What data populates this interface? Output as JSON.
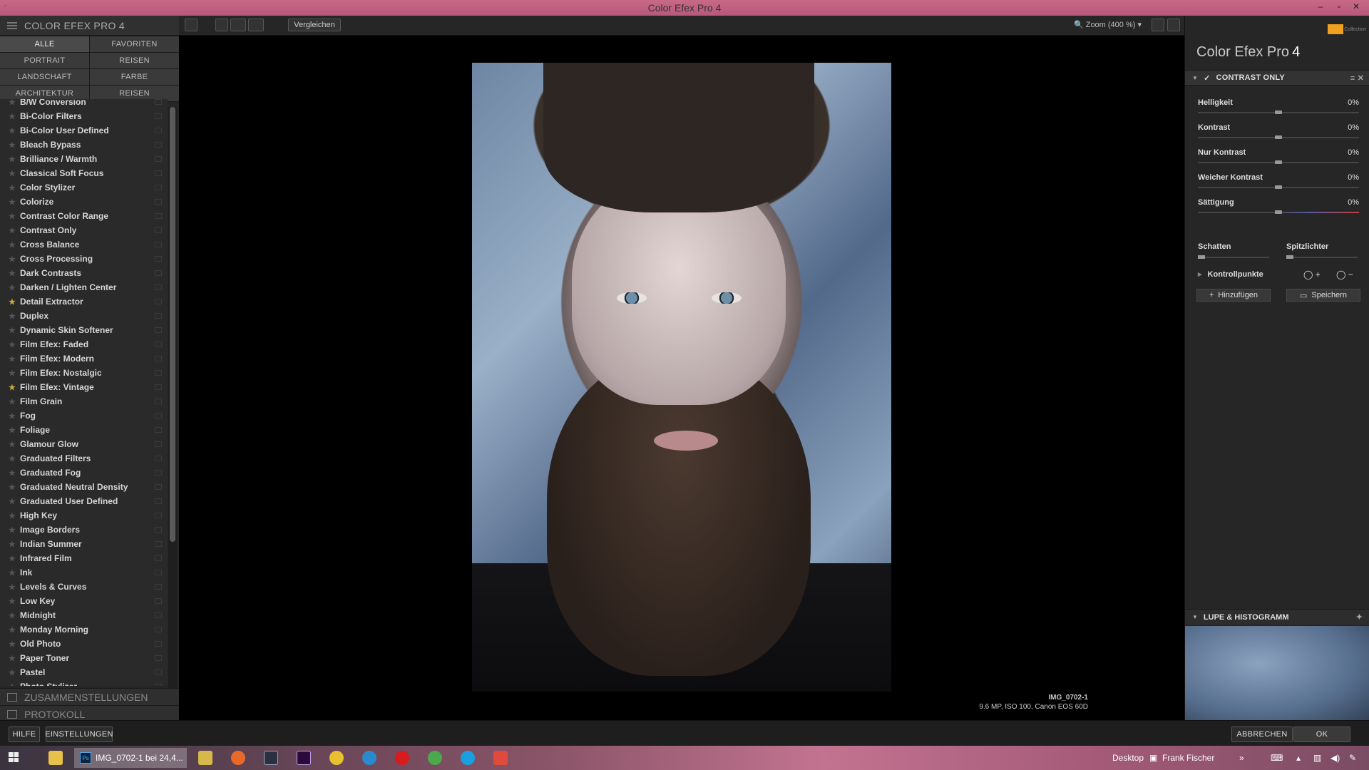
{
  "window": {
    "title": "Color Efex Pro 4"
  },
  "left_panel": {
    "header": "COLOR EFEX PRO 4",
    "categories": [
      {
        "label": "ALLE"
      },
      {
        "label": "FAVORITEN"
      },
      {
        "label": "PORTRAIT"
      },
      {
        "label": "REISEN"
      },
      {
        "label": "LANDSCHAFT"
      },
      {
        "label": "FARBE"
      },
      {
        "label": "ARCHITEKTUR"
      },
      {
        "label": "REISEN"
      }
    ],
    "filters": [
      {
        "label": "B/W Conversion",
        "fav": false
      },
      {
        "label": "Bi-Color Filters",
        "fav": false
      },
      {
        "label": "Bi-Color User Defined",
        "fav": false
      },
      {
        "label": "Bleach Bypass",
        "fav": false
      },
      {
        "label": "Brilliance / Warmth",
        "fav": false
      },
      {
        "label": "Classical Soft Focus",
        "fav": false
      },
      {
        "label": "Color Stylizer",
        "fav": false
      },
      {
        "label": "Colorize",
        "fav": false
      },
      {
        "label": "Contrast Color Range",
        "fav": false
      },
      {
        "label": "Contrast Only",
        "fav": false
      },
      {
        "label": "Cross Balance",
        "fav": false
      },
      {
        "label": "Cross Processing",
        "fav": false
      },
      {
        "label": "Dark Contrasts",
        "fav": false
      },
      {
        "label": "Darken / Lighten Center",
        "fav": false
      },
      {
        "label": "Detail Extractor",
        "fav": true
      },
      {
        "label": "Duplex",
        "fav": false
      },
      {
        "label": "Dynamic Skin Softener",
        "fav": false
      },
      {
        "label": "Film Efex: Faded",
        "fav": false
      },
      {
        "label": "Film Efex: Modern",
        "fav": false
      },
      {
        "label": "Film Efex: Nostalgic",
        "fav": false
      },
      {
        "label": "Film Efex: Vintage",
        "fav": true
      },
      {
        "label": "Film Grain",
        "fav": false
      },
      {
        "label": "Fog",
        "fav": false
      },
      {
        "label": "Foliage",
        "fav": false
      },
      {
        "label": "Glamour Glow",
        "fav": false
      },
      {
        "label": "Graduated Filters",
        "fav": false
      },
      {
        "label": "Graduated Fog",
        "fav": false
      },
      {
        "label": "Graduated Neutral Density",
        "fav": false
      },
      {
        "label": "Graduated User Defined",
        "fav": false
      },
      {
        "label": "High Key",
        "fav": false
      },
      {
        "label": "Image Borders",
        "fav": false
      },
      {
        "label": "Indian Summer",
        "fav": false
      },
      {
        "label": "Infrared Film",
        "fav": false
      },
      {
        "label": "Ink",
        "fav": false
      },
      {
        "label": "Levels & Curves",
        "fav": false
      },
      {
        "label": "Low Key",
        "fav": false
      },
      {
        "label": "Midnight",
        "fav": false
      },
      {
        "label": "Monday Morning",
        "fav": false
      },
      {
        "label": "Old Photo",
        "fav": false
      },
      {
        "label": "Paper Toner",
        "fav": false
      },
      {
        "label": "Pastel",
        "fav": false
      },
      {
        "label": "Photo Stylizer",
        "fav": false
      }
    ],
    "sections": {
      "recipes": "ZUSAMMENSTELLUNGEN",
      "history": "PROTOKOLL"
    }
  },
  "toolbar": {
    "compare": "Vergleichen",
    "zoom": "Zoom (400 %)"
  },
  "image": {
    "name": "IMG_0702-1",
    "meta": "9.6 MP, ISO 100, Canon EOS 60D"
  },
  "right_panel": {
    "brand": "Color Efex Pro",
    "brand_version": "4",
    "logo_text": "Collection",
    "filter_name": "CONTRAST ONLY",
    "sliders": [
      {
        "label": "Helligkeit",
        "value": "0%"
      },
      {
        "label": "Kontrast",
        "value": "0%"
      },
      {
        "label": "Nur Kontrast",
        "value": "0%"
      },
      {
        "label": "Weicher Kontrast",
        "value": "0%"
      },
      {
        "label": "Sättigung",
        "value": "0%"
      }
    ],
    "shadows": "Schatten",
    "highlights": "Spitzlichter",
    "control_points": "Kontrollpunkte",
    "add": "Hinzufügen",
    "save": "Speichern",
    "loupe": "LUPE & HISTOGRAMM"
  },
  "bottom": {
    "help": "HILFE",
    "settings": "EINSTELLUNGEN",
    "cancel": "ABBRECHEN",
    "ok": "OK"
  },
  "taskbar": {
    "active_app": "IMG_0702-1 bei 24,4...",
    "desktop": "Desktop",
    "user": "Frank Fischer"
  },
  "colors": {
    "titlebar": "#b7587a",
    "panel": "#262626",
    "favorite_star": "#cfa63a"
  }
}
